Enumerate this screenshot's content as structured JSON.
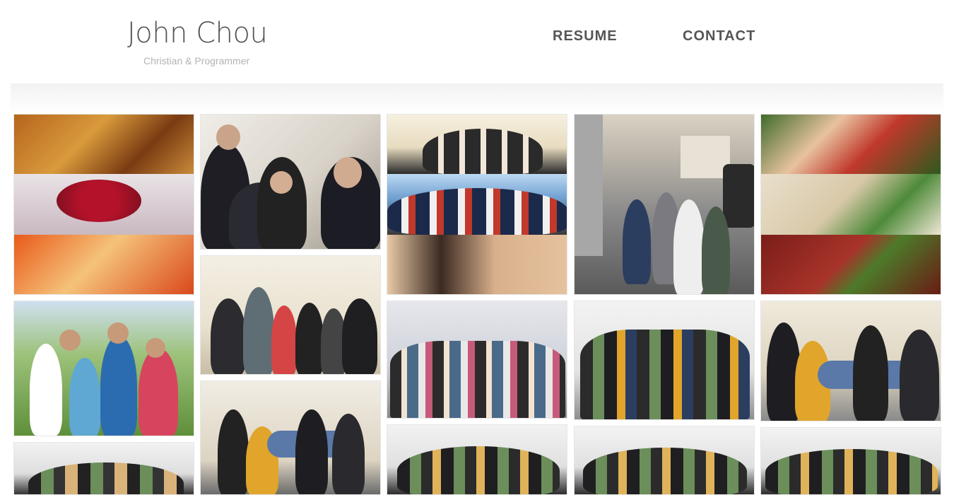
{
  "site": {
    "name": "John Chou",
    "tagline": "Christian & Programmer"
  },
  "nav": {
    "items": [
      {
        "label": "RESUME"
      },
      {
        "label": "CONTACT"
      }
    ]
  },
  "gallery": {
    "photos": [
      {
        "name": "food-collage-photo",
        "kind": "food-collage"
      },
      {
        "name": "friends-couch-photo",
        "kind": "group-indoor"
      },
      {
        "name": "group-collage-photo",
        "kind": "group-collage"
      },
      {
        "name": "street-walk-photo",
        "kind": "street"
      },
      {
        "name": "dinner-collage-photo",
        "kind": "food-collage"
      },
      {
        "name": "ziplining-photo",
        "kind": "outdoor"
      },
      {
        "name": "dancing-group-photo",
        "kind": "group-indoor"
      },
      {
        "name": "living-room-group-photo",
        "kind": "group-indoor"
      },
      {
        "name": "whiteboard-group-photo",
        "kind": "group-indoor"
      },
      {
        "name": "carry-pose-photo",
        "kind": "group-indoor"
      },
      {
        "name": "whiteboard-lineup-photo-1",
        "kind": "group-indoor"
      },
      {
        "name": "carry-pose-photo-2",
        "kind": "group-indoor"
      },
      {
        "name": "whiteboard-lineup-photo-2",
        "kind": "group-indoor"
      },
      {
        "name": "whiteboard-lineup-photo-3",
        "kind": "group-indoor"
      },
      {
        "name": "whiteboard-lineup-photo-4",
        "kind": "group-indoor"
      }
    ]
  },
  "colors": {
    "brand_text": "#555555",
    "tagline_text": "#b3b3b3",
    "nav_text": "#555555"
  }
}
